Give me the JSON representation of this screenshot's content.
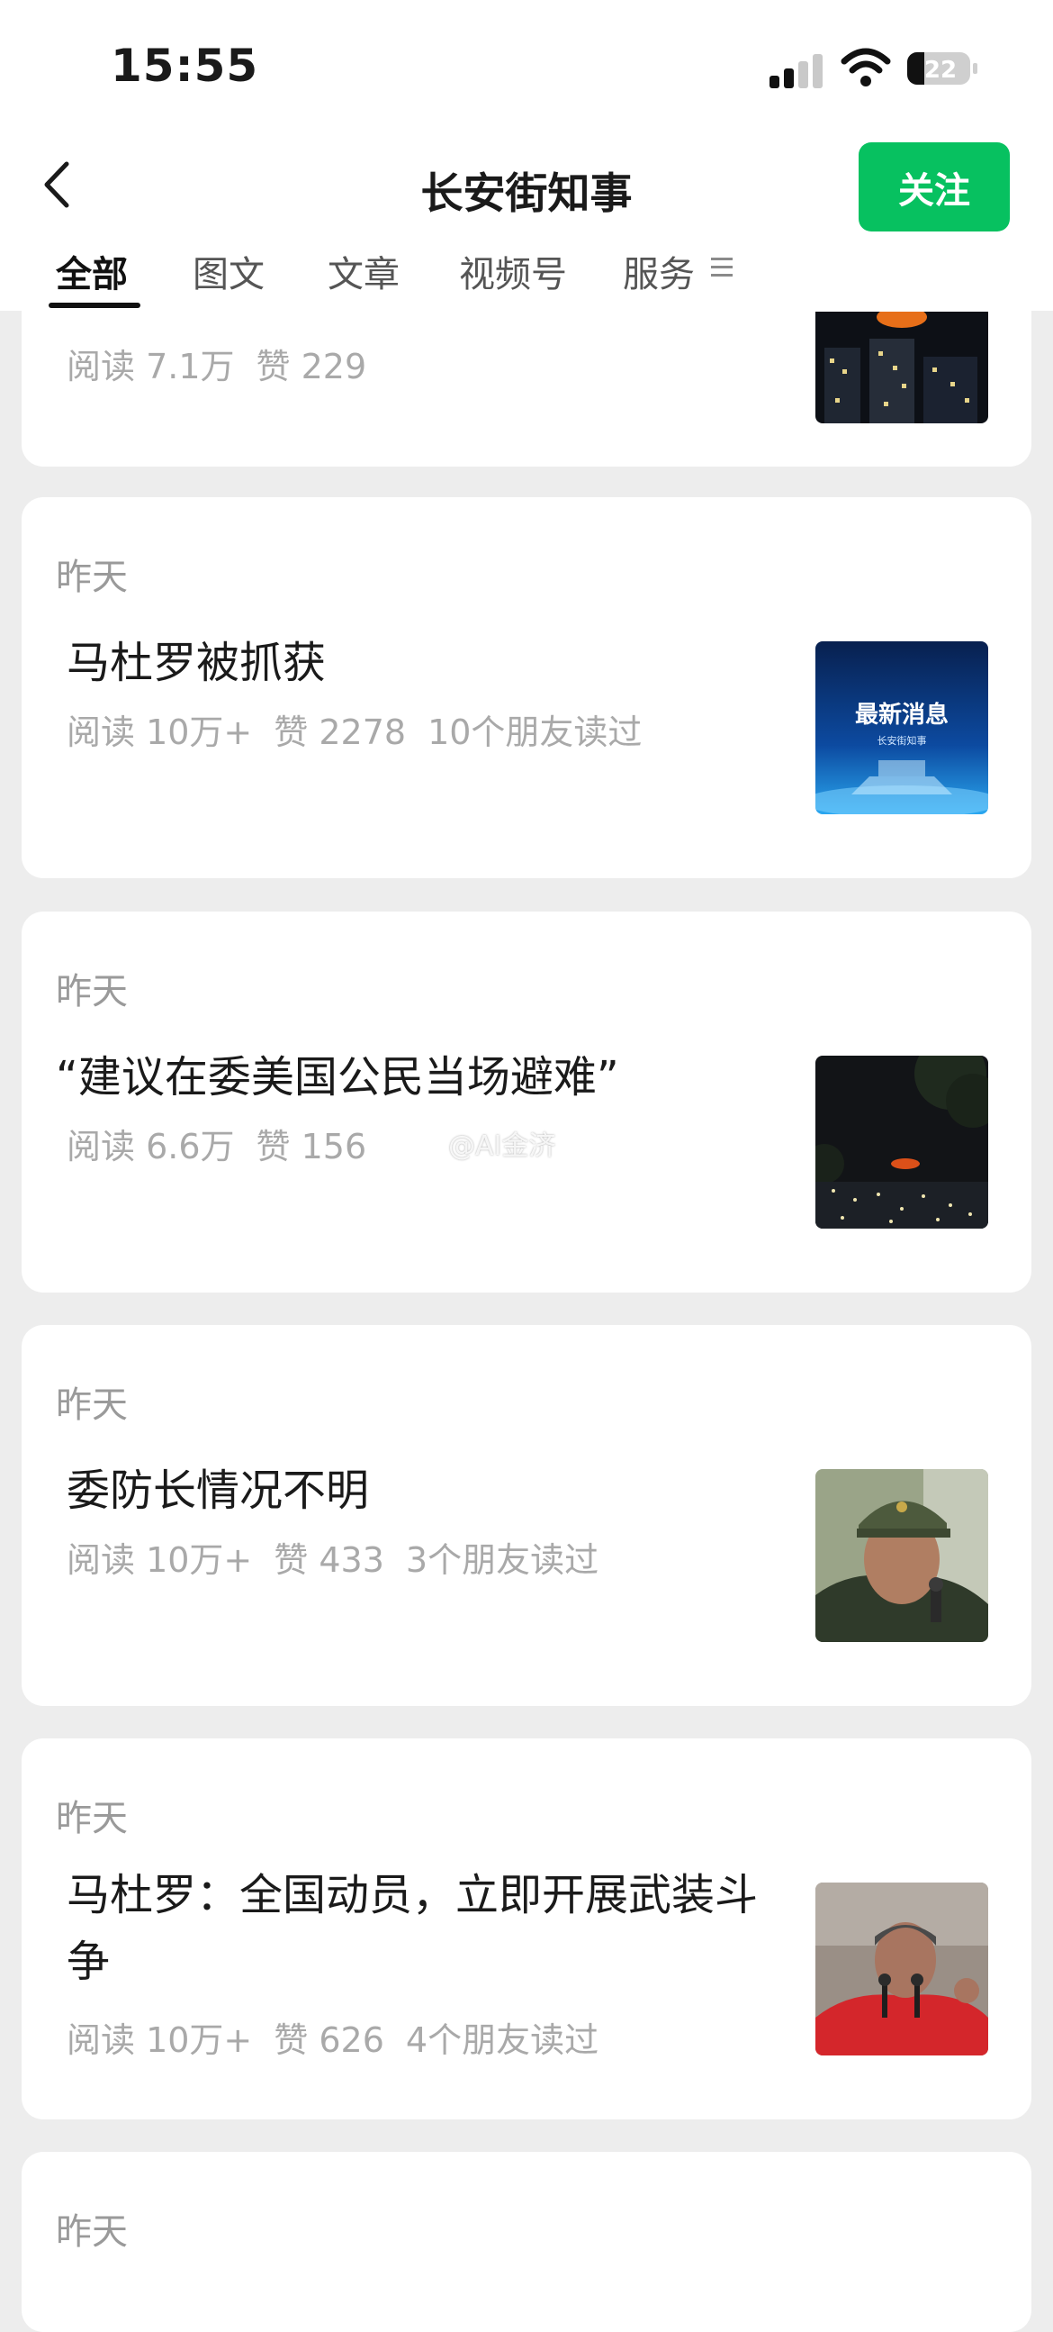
{
  "status_bar": {
    "time": "15:55",
    "battery": "22"
  },
  "header": {
    "title": "长安街知事",
    "follow_label": "关注"
  },
  "tabs": [
    {
      "label": "全部",
      "active": true
    },
    {
      "label": "图文",
      "active": false
    },
    {
      "label": "文章",
      "active": false
    },
    {
      "label": "视频号",
      "active": false
    },
    {
      "label": "服务",
      "active": false
    }
  ],
  "feed": [
    {
      "title": "",
      "reads": "阅读 7.1万",
      "likes": "赞 229",
      "friends": "",
      "thumb_icon": "night-fire-image"
    },
    {
      "date": "昨天",
      "title": "马杜罗被抓获",
      "reads": "阅读 10万+",
      "likes": "赞 2278",
      "friends": "10个朋友读过",
      "thumb_text": "最新消息",
      "thumb_subtext": "长安街知事",
      "thumb_icon": "breaking-news-image"
    },
    {
      "date": "昨天",
      "title": "“建议在委美国公民当场避难”",
      "reads": "阅读 6.6万",
      "likes": "赞 156",
      "friends": "",
      "thumb_icon": "night-city-image"
    },
    {
      "date": "昨天",
      "title": "委防长情况不明",
      "reads": "阅读 10万+",
      "likes": "赞 433",
      "friends": "3个朋友读过",
      "thumb_icon": "military-officer-photo"
    },
    {
      "date": "昨天",
      "title": "马杜罗：全国动员，立即开展武装斗争",
      "reads": "阅读 10万+",
      "likes": "赞 626",
      "friends": "4个朋友读过",
      "thumb_icon": "speaker-photo"
    },
    {
      "date": "昨天"
    }
  ],
  "watermark": "@AI金济",
  "colors": {
    "accent": "#07c160",
    "background": "#ededed",
    "meta_text": "#a9a9a9"
  }
}
